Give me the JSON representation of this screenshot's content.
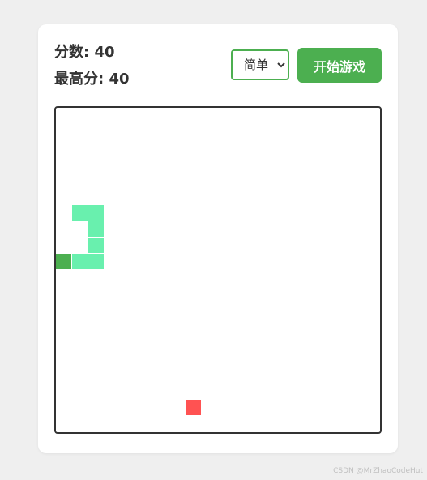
{
  "score": {
    "label": "分数: 40"
  },
  "high_score": {
    "label": "最高分: 40"
  },
  "difficulty": {
    "options": [
      "简单"
    ],
    "selected": "简单"
  },
  "start_button": {
    "label": "开始游戏"
  },
  "board": {
    "grid_size": 20,
    "snake": [
      {
        "col": 0,
        "row": 9
      },
      {
        "col": 1,
        "row": 9
      },
      {
        "col": 2,
        "row": 9
      },
      {
        "col": 2,
        "row": 8
      },
      {
        "col": 2,
        "row": 7
      },
      {
        "col": 2,
        "row": 6
      },
      {
        "col": 1,
        "row": 6
      }
    ],
    "food": {
      "col": 8,
      "row": 18
    }
  },
  "colors": {
    "snake_head": "#4caf50",
    "snake_body": "#69f0ae",
    "food": "#ff5252",
    "accent": "#4caf50"
  },
  "watermark": "CSDN @MrZhaoCodeHut"
}
